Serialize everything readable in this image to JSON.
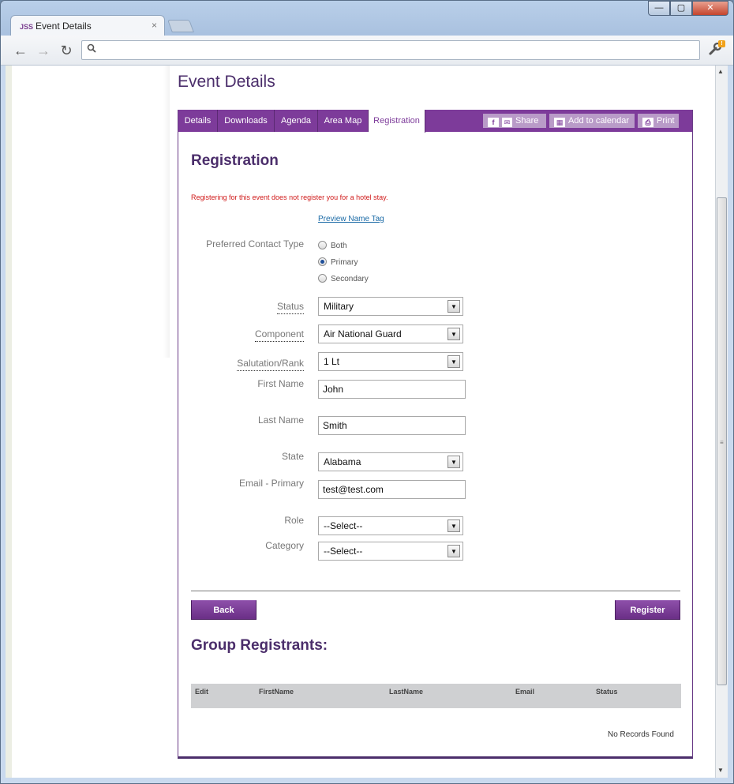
{
  "browser": {
    "tab_title": "Event Details",
    "favicon_text": "JSS",
    "tab_close": "×",
    "window_buttons": {
      "minimize": "—",
      "maximize": "▢",
      "close": "✕"
    },
    "nav": {
      "back": "←",
      "forward": "→",
      "reload": "↻"
    },
    "address_value": "",
    "search_icon": "search-icon",
    "wrench_badge": "!"
  },
  "page": {
    "title": "Event Details",
    "tabs": [
      {
        "label": "Details"
      },
      {
        "label": "Downloads"
      },
      {
        "label": "Agenda"
      },
      {
        "label": "Area Map"
      },
      {
        "label": "Registration",
        "active": true
      }
    ],
    "tools": {
      "share": "Share",
      "calendar": "Add to calendar",
      "print": "Print"
    }
  },
  "registration": {
    "heading": "Registration",
    "notice": "Registering for this event does not register you for a hotel stay.",
    "preview_link": "Preview Name Tag",
    "contact_type": {
      "label": "Preferred Contact Type",
      "options": [
        "Both",
        "Primary",
        "Secondary"
      ],
      "selected": "Primary"
    },
    "fields": {
      "status": {
        "label": "Status",
        "value": "Military"
      },
      "component": {
        "label": "Component",
        "value": "Air National Guard"
      },
      "rank": {
        "label": "Salutation/Rank",
        "value": "1 Lt"
      },
      "first_name": {
        "label": "First Name",
        "value": "John"
      },
      "last_name": {
        "label": "Last Name",
        "value": "Smith"
      },
      "state": {
        "label": "State",
        "value": "Alabama"
      },
      "email": {
        "label": "Email - Primary",
        "value": "test@test.com"
      },
      "role": {
        "label": "Role",
        "value": "--Select--"
      },
      "category": {
        "label": "Category",
        "value": "--Select--"
      }
    },
    "back_button": "Back",
    "register_button": "Register"
  },
  "group": {
    "heading": "Group Registrants:",
    "columns": [
      "Edit",
      "FirstName",
      "LastName",
      "Email",
      "Status"
    ],
    "empty_text": "No Records Found"
  },
  "colors": {
    "brand_purple": "#7d3b9a",
    "heading_purple": "#4b2e6b",
    "notice_red": "#d01a1a",
    "link_blue": "#1a6aa6"
  }
}
